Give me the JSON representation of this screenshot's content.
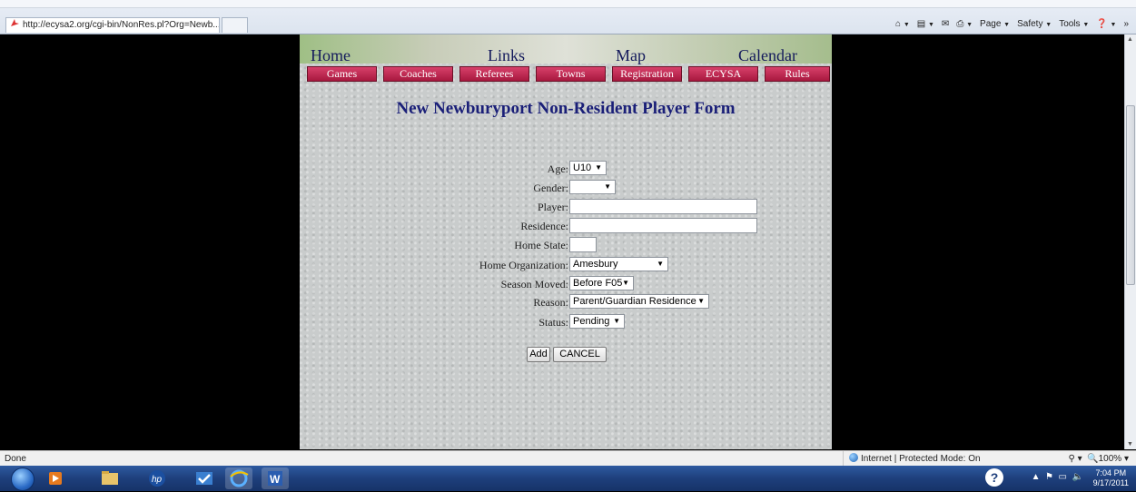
{
  "browser": {
    "tab_url": "http://ecysa2.org/cgi-bin/NonRes.pl?Org=Newb...",
    "commands": {
      "page": "Page",
      "safety": "Safety",
      "tools": "Tools",
      "more": "»"
    }
  },
  "site": {
    "main_nav": [
      "Home",
      "Links",
      "Map",
      "Calendar"
    ],
    "sub_nav": [
      "Games",
      "Coaches",
      "Referees",
      "Towns",
      "Registration",
      "ECYSA",
      "Rules"
    ],
    "accent_color": "#b3204a"
  },
  "form": {
    "title": "New Newburyport Non-Resident Player Form",
    "fields": {
      "age": {
        "label": "Age:",
        "value": "U10"
      },
      "gender": {
        "label": "Gender:",
        "value": ""
      },
      "player": {
        "label": "Player:",
        "value": ""
      },
      "residence": {
        "label": "Residence:",
        "value": ""
      },
      "home_state": {
        "label": "Home State:",
        "value": ""
      },
      "home_org": {
        "label": "Home Organization:",
        "value": "Amesbury"
      },
      "season_moved": {
        "label": "Season Moved:",
        "value": "Before F05"
      },
      "reason": {
        "label": "Reason:",
        "value": "Parent/Guardian Residence"
      },
      "status": {
        "label": "Status:",
        "value": "Pending"
      }
    },
    "buttons": {
      "add": "Add",
      "cancel": "CANCEL"
    }
  },
  "statusbar": {
    "left": "Done",
    "zone": "Internet | Protected Mode: On",
    "zoom": "100%"
  },
  "taskbar": {
    "time": "7:04 PM",
    "date": "9/17/2011"
  }
}
